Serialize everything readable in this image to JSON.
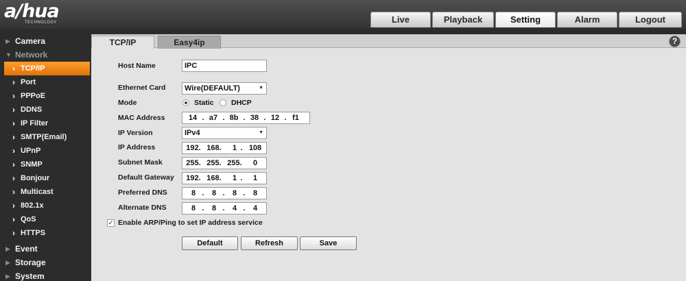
{
  "brand": {
    "name": "a/hua",
    "tagline": "TECHNOLOGY"
  },
  "main_tabs": [
    {
      "label": "Live"
    },
    {
      "label": "Playback"
    },
    {
      "label": "Setting",
      "active": true
    },
    {
      "label": "Alarm"
    },
    {
      "label": "Logout"
    }
  ],
  "sidebar": {
    "items": [
      {
        "label": "Camera",
        "level": 0
      },
      {
        "label": "Network",
        "level": 0,
        "expanded": true
      },
      {
        "label": "TCP/IP",
        "level": 1,
        "active": true
      },
      {
        "label": "Port",
        "level": 1
      },
      {
        "label": "PPPoE",
        "level": 1
      },
      {
        "label": "DDNS",
        "level": 1
      },
      {
        "label": "IP Filter",
        "level": 1
      },
      {
        "label": "SMTP(Email)",
        "level": 1
      },
      {
        "label": "UPnP",
        "level": 1
      },
      {
        "label": "SNMP",
        "level": 1
      },
      {
        "label": "Bonjour",
        "level": 1
      },
      {
        "label": "Multicast",
        "level": 1
      },
      {
        "label": "802.1x",
        "level": 1
      },
      {
        "label": "QoS",
        "level": 1
      },
      {
        "label": "HTTPS",
        "level": 1
      },
      {
        "label": "Event",
        "level": 0
      },
      {
        "label": "Storage",
        "level": 0
      },
      {
        "label": "System",
        "level": 0
      }
    ]
  },
  "sub_tabs": [
    {
      "label": "TCP/IP",
      "active": true
    },
    {
      "label": "Easy4ip"
    }
  ],
  "help_label": "?",
  "form": {
    "host_name": {
      "label": "Host Name",
      "value": "IPC"
    },
    "ethernet_card": {
      "label": "Ethernet Card",
      "value": "Wire(DEFAULT)"
    },
    "mode": {
      "label": "Mode",
      "options": [
        "Static",
        "DHCP"
      ],
      "selected": "Static"
    },
    "mac_address": {
      "label": "MAC Address",
      "segments": [
        "14",
        "a7",
        "8b",
        "38",
        "12",
        "f1"
      ]
    },
    "ip_version": {
      "label": "IP Version",
      "value": "IPv4"
    },
    "ip_address": {
      "label": "IP Address",
      "octets": [
        "192.",
        "168.",
        "1",
        "108"
      ]
    },
    "subnet_mask": {
      "label": "Subnet Mask",
      "octets": [
        "255.",
        "255.",
        "255.",
        "0"
      ]
    },
    "default_gateway": {
      "label": "Default Gateway",
      "octets": [
        "192.",
        "168.",
        "1",
        "1"
      ]
    },
    "preferred_dns": {
      "label": "Preferred DNS",
      "octets": [
        "8",
        "8",
        "8",
        "8"
      ]
    },
    "alternate_dns": {
      "label": "Alternate DNS",
      "octets": [
        "8",
        "8",
        "4",
        "4"
      ]
    },
    "arp_ping": {
      "label": "Enable ARP/Ping to set IP address service",
      "checked": true
    }
  },
  "buttons": {
    "default": "Default",
    "refresh": "Refresh",
    "save": "Save"
  }
}
